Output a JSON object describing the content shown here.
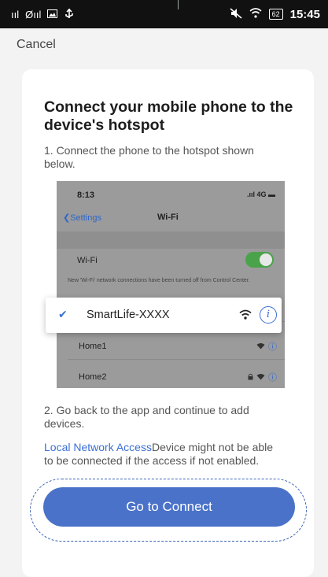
{
  "status_bar": {
    "left_signal": "ııl",
    "left_signal2": "Øııl",
    "time": "15:45",
    "battery": "62"
  },
  "nav": {
    "cancel_label": "Cancel"
  },
  "instructions": {
    "title": "Connect your mobile phone to the device's hotspot",
    "step1": "1. Connect the phone to the hotspot shown below.",
    "step2": "2. Go back to the app and continue to add devices.",
    "note_link": "Local Network Access",
    "note_text": "Device might not be able to be connected if the access if not enabled."
  },
  "phone_screenshot": {
    "time": "8:13",
    "status": "4G",
    "back_label": "Settings",
    "title": "Wi-Fi",
    "wifi_label": "Wi-Fi",
    "wifi_on": true,
    "notice": "New 'Wi-Fi' network connections have been turned off from Control Center.",
    "highlighted_network": "SmartLife-XXXX",
    "networks": [
      {
        "name": "Home1",
        "locked": false
      },
      {
        "name": "Home2",
        "locked": true
      }
    ]
  },
  "actions": {
    "connect_label": "Go to Connect"
  },
  "colors": {
    "accent": "#4a72c8",
    "link": "#3b6fd4",
    "toggle_on": "#4aa34b"
  }
}
